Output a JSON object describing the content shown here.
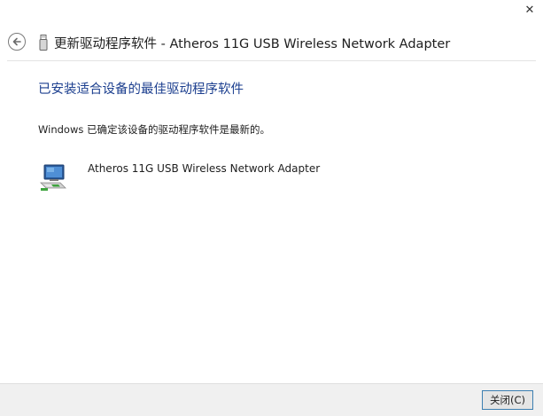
{
  "window": {
    "close_glyph": "✕"
  },
  "header": {
    "title": "更新驱动程序软件 - Atheros 11G USB Wireless Network Adapter",
    "back_icon": "back-arrow-icon",
    "device_icon": "usb-device-icon"
  },
  "main": {
    "heading": "已安装适合设备的最佳驱动程序软件",
    "status_text": "Windows 已确定该设备的驱动程序软件是最新的。",
    "device": {
      "icon": "network-adapter-icon",
      "name": "Atheros 11G USB Wireless Network Adapter"
    }
  },
  "footer": {
    "close_label": "关闭(C)"
  },
  "colors": {
    "heading": "#1c3f8f",
    "footer_bg": "#f0f0f0",
    "button_border": "#3c7fb1"
  }
}
